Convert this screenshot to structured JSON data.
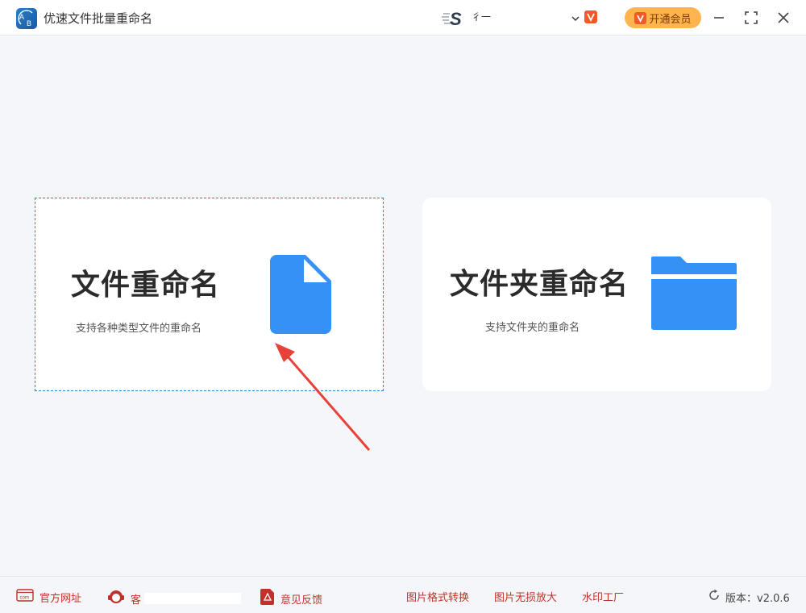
{
  "app": {
    "title": "优速文件批量重命名",
    "logo_text": "AB"
  },
  "titlebar": {
    "user_logo_text": "S",
    "user_name": "彳一",
    "vip_button_label": "开通会员",
    "vip_badge_icon": "vip-icon"
  },
  "cards": [
    {
      "title": "文件重命名",
      "description": "支持各种类型文件的重命名",
      "icon": "file-icon",
      "selected": true
    },
    {
      "title": "文件夹重命名",
      "description": "支持文件夹的重命名",
      "icon": "folder-icon",
      "selected": false
    }
  ],
  "footer": {
    "site_label": "官方网址",
    "site_icon_text": "com",
    "service_label": "客",
    "feedback_label": "意见反馈",
    "links": [
      "图片格式转换",
      "图片无损放大",
      "水印工厂"
    ],
    "version_label": "版本：v2.0.6"
  },
  "colors": {
    "accent_blue": "#3591f5",
    "vip_orange": "#ffb44d",
    "footer_red": "#c0322b",
    "arrow_red": "#e8413a"
  }
}
